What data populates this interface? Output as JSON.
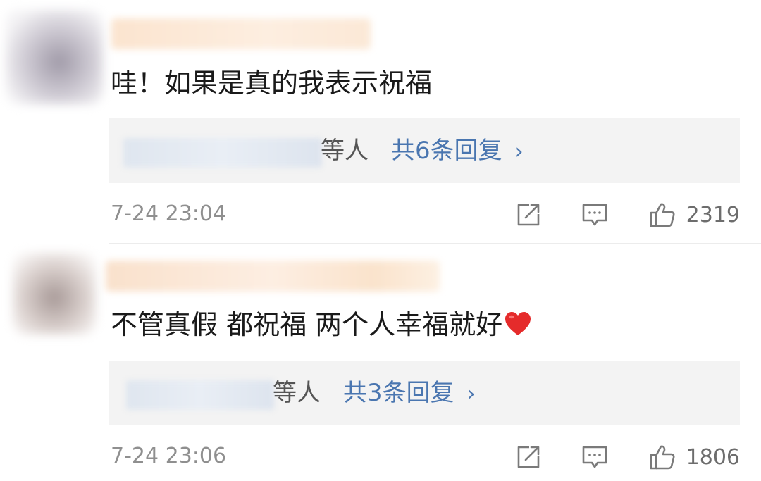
{
  "comments": [
    {
      "text": "哇！如果是真的我表示祝福",
      "reply_suffix": "等人",
      "reply_count_label": "共6条回复",
      "reply_chevron": "›",
      "time": "7-24 23:04",
      "like_count": "2319"
    },
    {
      "text": "不管真假 都祝福 两个人幸福就好",
      "emoji": "heart",
      "reply_suffix": "等人",
      "reply_count_label": "共3条回复",
      "reply_chevron": "›",
      "time": "7-24 23:06",
      "like_count": "1806"
    }
  ],
  "icons": {
    "share": "share-icon",
    "comment": "comment-icon",
    "like": "thumbs-up-icon",
    "heart": "red-heart-emoji"
  },
  "colors": {
    "link": "#4a76b0",
    "heart": "#e52b2b",
    "muted": "#8f8f8f"
  }
}
